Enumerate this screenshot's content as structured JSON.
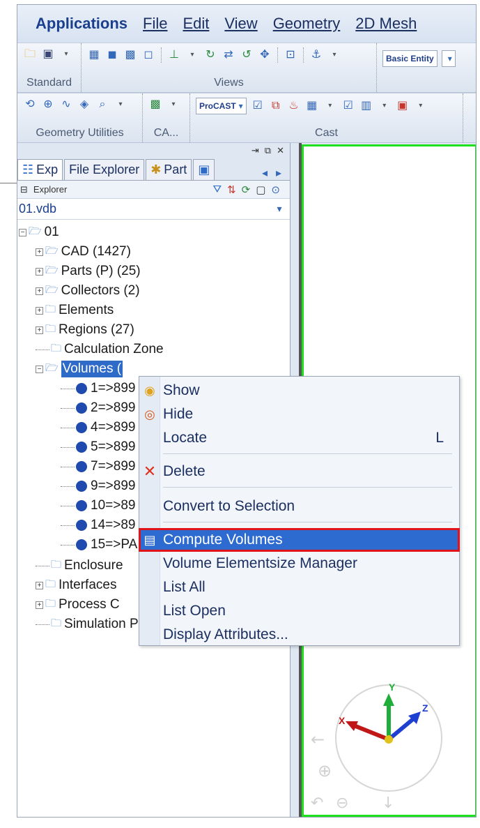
{
  "menubar": {
    "items": [
      "Applications",
      "File",
      "Edit",
      "View",
      "Geometry",
      "2D Mesh"
    ]
  },
  "toolbar": {
    "groups": [
      "Standard",
      "Views",
      "Geometry Utilities",
      "CA...",
      "Cast"
    ],
    "basic_entity": "Basic Entity",
    "procast": "ProCAST"
  },
  "panel": {
    "tabs": [
      "Exp",
      "File Explorer",
      "Part"
    ],
    "explorer_label": "Explorer",
    "vdb_file": "01.vdb"
  },
  "tree": {
    "root": "01",
    "nodes": [
      "CAD (1427)",
      "Parts (P) (25)",
      "Collectors (2)",
      "Elements",
      "Regions (27)",
      "Calculation Zone",
      "Volumes (",
      "1=>899",
      "2=>899",
      "4=>899",
      "5=>899",
      "7=>899",
      "9=>899",
      "10=>89",
      "14=>89",
      "15=>PA",
      "Enclosure",
      "Interfaces",
      "Process C",
      "Simulation Parameters"
    ]
  },
  "context_menu": {
    "items": [
      {
        "label": "Show",
        "icon": "show-icon"
      },
      {
        "label": "Hide",
        "icon": "hide-icon"
      },
      {
        "label": "Locate",
        "shortcut": "L"
      },
      {
        "label": "Delete",
        "icon": "delete-icon"
      },
      {
        "label": "Convert to Selection"
      },
      {
        "label": "Compute Volumes",
        "icon": "compute-icon",
        "highlighted": true
      },
      {
        "label": "Volume Elementsize Manager"
      },
      {
        "label": "List All"
      },
      {
        "label": "List Open"
      },
      {
        "label": "Display Attributes..."
      }
    ]
  },
  "viewport": {
    "axes": {
      "x": "X",
      "y": "Y",
      "z": "Z"
    },
    "colors": {
      "x": "#c01818",
      "y": "#1fae3a",
      "z": "#1f3fd0",
      "border": "#1ee01e"
    }
  }
}
